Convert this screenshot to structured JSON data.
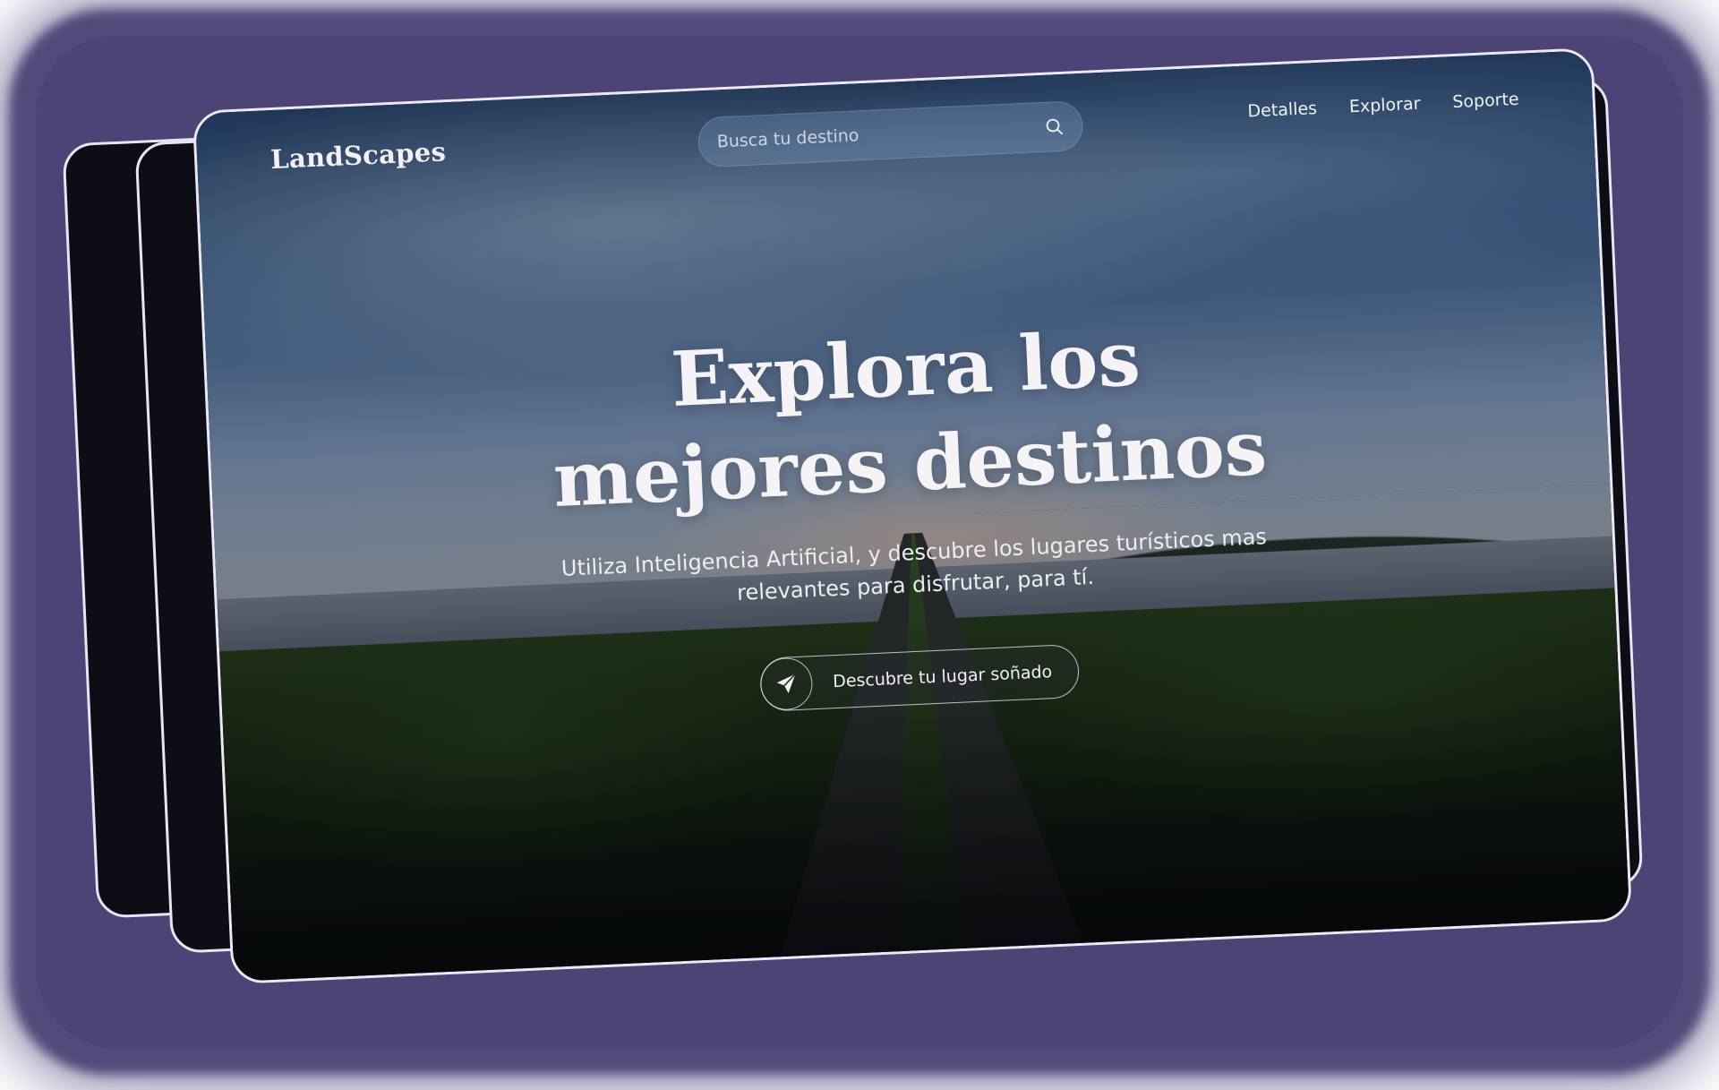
{
  "header": {
    "logo": "LandScapes",
    "search": {
      "placeholder": "Busca tu destino",
      "icon": "search-icon"
    },
    "nav": [
      {
        "label": "Detalles"
      },
      {
        "label": "Explorar"
      },
      {
        "label": "Soporte"
      }
    ]
  },
  "hero": {
    "title_line1": "Explora los",
    "title_line2": "mejores destinos",
    "subtitle_line1": "Utiliza Inteligencia Artificial, y descubre los lugares turísticos mas",
    "subtitle_line2": "relevantes para disfrutar, para tí.",
    "cta": {
      "label": "Descubre tu lugar soñado",
      "icon": "paper-plane-icon"
    }
  },
  "colors": {
    "backdrop": "#534a7a",
    "card_border": "#ece8f6",
    "card_back": "#0d0d16",
    "text": "#f5f3f5"
  }
}
